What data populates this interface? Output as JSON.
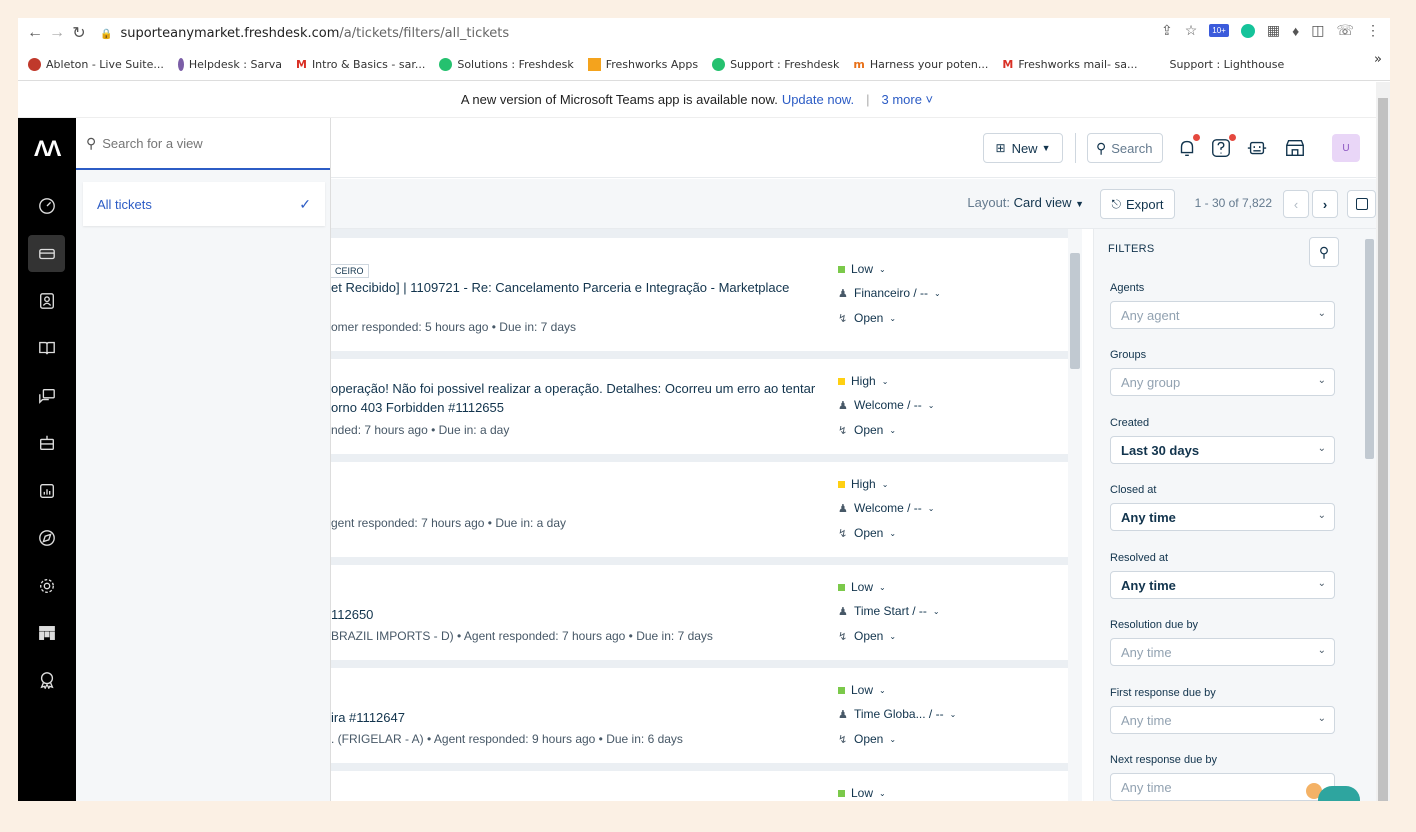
{
  "browser": {
    "url_host": "suporteanymarket.freshdesk.com",
    "url_path": "/a/tickets/filters/all_tickets",
    "bookmarks": [
      {
        "label": "Ableton - Live Suite...",
        "color": "#c0392b"
      },
      {
        "label": "Helpdesk : Sarva",
        "color": "#7b5ea7"
      },
      {
        "label": "Intro & Basics - sar...",
        "color": "#d93025"
      },
      {
        "label": "Solutions : Freshdesk",
        "color": "#25c16f"
      },
      {
        "label": "Freshworks Apps",
        "color": "#f4a31d"
      },
      {
        "label": "Support : Freshdesk",
        "color": "#25c16f"
      },
      {
        "label": "Harness your poten...",
        "color": "#e8711a"
      },
      {
        "label": "Freshworks mail- sa...",
        "color": "#d93025"
      },
      {
        "label": "Support : Lighthouse",
        "color": ""
      }
    ],
    "more": "»"
  },
  "notice": {
    "text": "A new version of Microsoft Teams app is available now.",
    "link": "Update now.",
    "more": "3 more ˅"
  },
  "view_panel": {
    "search_placeholder": "Search for a view",
    "selected_view": "All tickets"
  },
  "header": {
    "new_label": "New",
    "search_label": "Search",
    "avatar_initial": "U"
  },
  "toolbar": {
    "layout_label": "Layout:",
    "layout_value": "Card view",
    "export_label": "Export",
    "pager_text": "1 - 30 of 7,822"
  },
  "tickets": [
    {
      "tag": "CEIRO",
      "subject_lines": [
        "et Recibido] | 1109721 - Re: Cancelamento Parceria e Integração - Marketplace"
      ],
      "meta": "omer responded: 5 hours ago  •  Due in: 7 days",
      "priority": "Low",
      "priority_color": "#7bc94a",
      "group": "Financeiro / --",
      "status": "Open"
    },
    {
      "tag": "",
      "subject_lines": [
        "operação! Não foi possivel realizar a operação. Detalhes: Ocorreu um erro ao tentar",
        "orno 403 Forbidden #1112655"
      ],
      "meta": "nded: 7 hours ago  •  Due in: a day",
      "priority": "High",
      "priority_color": "#ffd012",
      "group": "Welcome / --",
      "status": "Open"
    },
    {
      "tag": "",
      "subject_lines": [],
      "meta": "gent responded: 7 hours ago  •  Due in: a day",
      "priority": "High",
      "priority_color": "#ffd012",
      "group": "Welcome / --",
      "status": "Open"
    },
    {
      "tag": "",
      "subject_lines": [
        "112650"
      ],
      "meta": "BRAZIL IMPORTS - D)  •  Agent responded: 7 hours ago  •  Due in: 7 days",
      "priority": "Low",
      "priority_color": "#7bc94a",
      "group": "Time Start / --",
      "status": "Open"
    },
    {
      "tag": "",
      "subject_lines": [
        "ira #1112647"
      ],
      "meta": ". (FRIGELAR - A)  •  Agent responded: 9 hours ago  •  Due in: 6 days",
      "priority": "Low",
      "priority_color": "#7bc94a",
      "group": "Time Globa... / --",
      "status": "Open"
    },
    {
      "tag": "",
      "subject_lines": [],
      "meta": "",
      "priority": "Low",
      "priority_color": "#7bc94a",
      "group": "",
      "status": ""
    }
  ],
  "filters": {
    "title": "FILTERS",
    "fields": [
      {
        "label": "Agents",
        "value": "Any agent",
        "set": false
      },
      {
        "label": "Groups",
        "value": "Any group",
        "set": false
      },
      {
        "label": "Created",
        "value": "Last 30 days",
        "set": true
      },
      {
        "label": "Closed at",
        "value": "Any time",
        "set": true
      },
      {
        "label": "Resolved at",
        "value": "Any time",
        "set": true
      },
      {
        "label": "Resolution due by",
        "value": "Any time",
        "set": false
      },
      {
        "label": "First response due by",
        "value": "Any time",
        "set": false
      },
      {
        "label": "Next response due by",
        "value": "Any time",
        "set": false
      }
    ]
  }
}
